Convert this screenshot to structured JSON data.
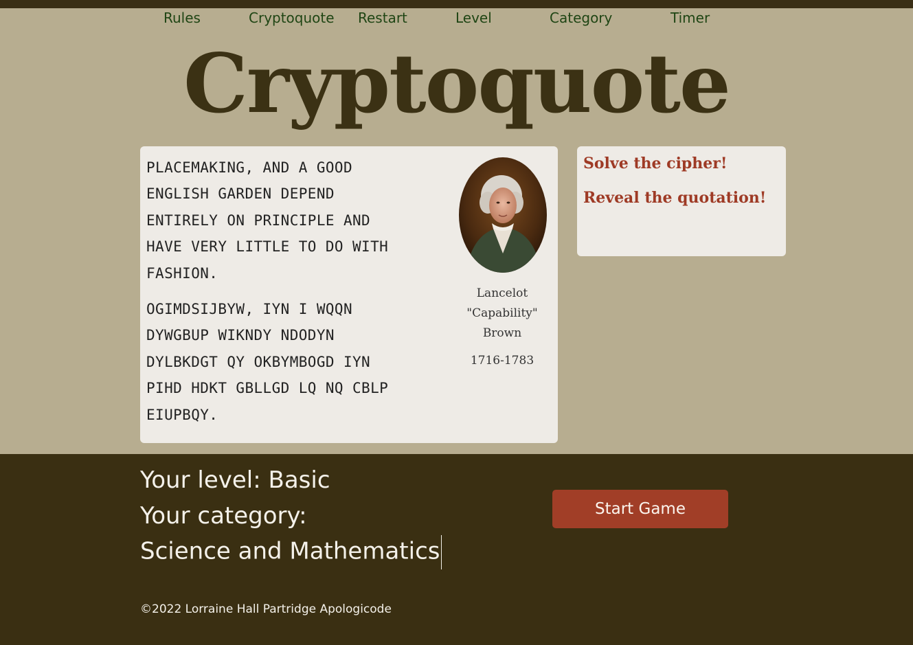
{
  "nav": {
    "items": [
      {
        "label": "Rules"
      },
      {
        "label": "Cryptoquote"
      },
      {
        "label": "Restart"
      },
      {
        "label": "Level"
      },
      {
        "label": "Category"
      },
      {
        "label": "Timer"
      }
    ]
  },
  "header": {
    "title": "Cryptoquote"
  },
  "quote_card": {
    "plain_lines": [
      "PLACEMAKING, AND A GOOD",
      "ENGLISH GARDEN DEPEND",
      "ENTIRELY ON PRINCIPLE AND",
      "HAVE VERY LITTLE TO DO WITH",
      "FASHION."
    ],
    "cipher_lines": [
      "OGIMDSIJBYW, IYN I WQQN",
      "DYWGBUP WIKNDY NDODYN",
      "DYLBKDGT QY OKBYMBOGD IYN",
      "PIHD HDKT GBLLGD LQ NQ CBLP",
      "EIUPBQY."
    ],
    "author": {
      "lines": [
        "Lancelot",
        "\"Capability\"",
        "Brown"
      ],
      "dates": "1716-1783"
    }
  },
  "side_card": {
    "line1": "Solve the cipher!",
    "line2": "Reveal the quotation!"
  },
  "footer": {
    "level_line": "Your level: Basic",
    "category_line": "Your category:",
    "category_value": "Science and Mathematics",
    "start_button": "Start Game",
    "copyright": "©2022 Lorraine Hall Partridge Apologicode"
  },
  "colors": {
    "background": "#b7ad90",
    "footer": "#3a2f12",
    "nav_text": "#1f4514",
    "title": "#3b3114",
    "accent": "#a13e27",
    "card": "#eeebe6"
  },
  "icons": {
    "portrait": "portrait-image"
  }
}
